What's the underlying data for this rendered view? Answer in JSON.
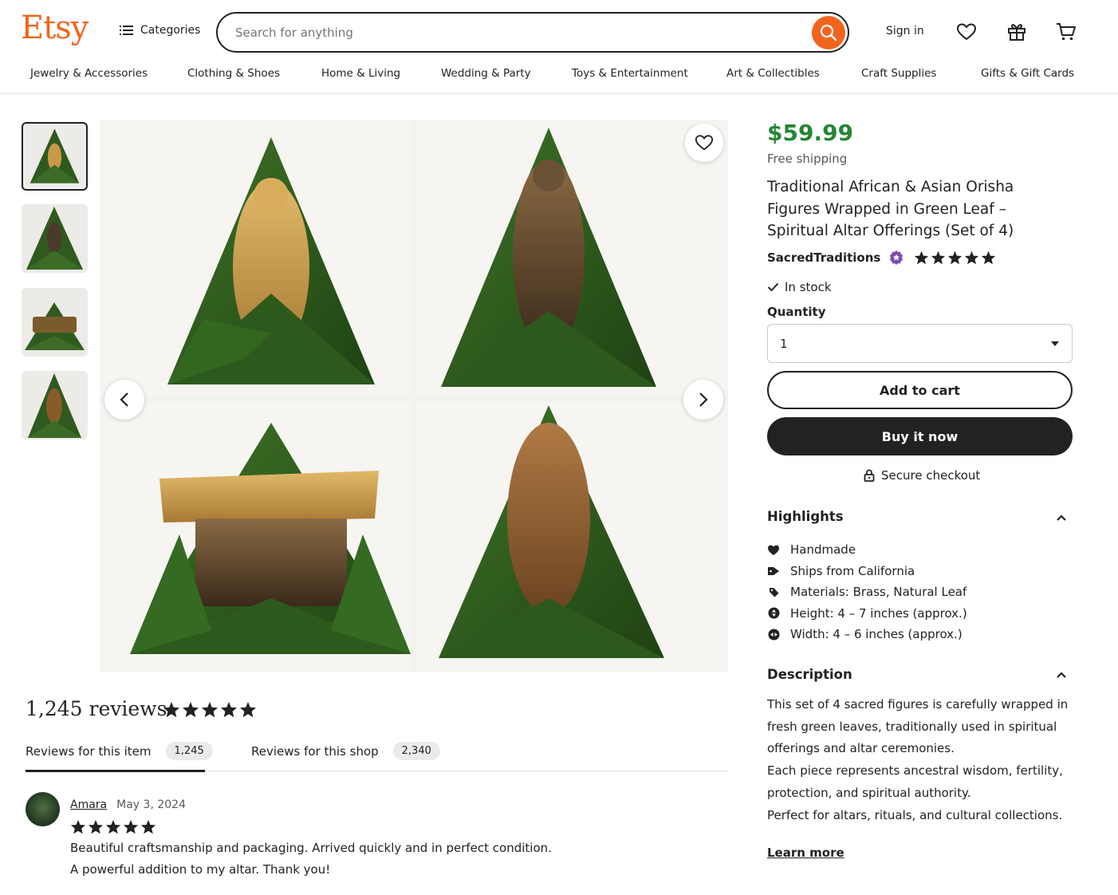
{
  "header": {
    "logo": "Etsy",
    "categories_label": "Categories",
    "search_placeholder": "Search for anything",
    "sign_in": "Sign in"
  },
  "nav": [
    "Jewelry & Accessories",
    "Clothing & Shoes",
    "Home & Living",
    "Wedding & Party",
    "Toys & Entertainment",
    "Art & Collectibles",
    "Craft Supplies",
    "Gifts & Gift Cards"
  ],
  "colors": {
    "brand": "#f1641e",
    "price": "#258635",
    "leaf": "#2f5a1f",
    "badge": "#7d4ab0"
  },
  "gallery": {
    "thumbnails": [
      "thumbnail-fertility-figure",
      "thumbnail-seated-deity",
      "thumbnail-carved-stool",
      "thumbnail-bronze-figure"
    ],
    "active_index": 0
  },
  "product": {
    "price": "$59.99",
    "shipping": "Free shipping",
    "title": "Traditional African & Asian Orisha Figures Wrapped in Green Leaf – Spiritual Altar Offerings (Set of 4)",
    "shop_name": "SacredTraditions",
    "shop_rating": 5,
    "stock": "In stock",
    "quantity_label": "Quantity",
    "quantity_value": "1",
    "add_to_cart": "Add to cart",
    "buy_now": "Buy it now",
    "secure_checkout": "Secure checkout"
  },
  "highlights": {
    "heading": "Highlights",
    "items": [
      {
        "icon": "heart-hand-icon",
        "text": "Handmade"
      },
      {
        "icon": "tag-icon",
        "text": "Ships from California"
      },
      {
        "icon": "materials-icon",
        "text": "Materials: Brass, Natural Leaf"
      },
      {
        "icon": "height-icon",
        "text": "Height: 4 – 7 inches (approx.)"
      },
      {
        "icon": "width-icon",
        "text": "Width: 4 – 6 inches (approx.)"
      }
    ]
  },
  "description": {
    "heading": "Description",
    "paragraphs": [
      "This set of 4 sacred figures is carefully wrapped in fresh green leaves, traditionally used in spiritual offerings and altar ceremonies.",
      "Each piece represents ancestral wisdom, fertility, protection, and spiritual authority.",
      "Perfect for altars, rituals, and cultural collections."
    ],
    "learn_more": "Learn more"
  },
  "reviews": {
    "count_label": "1,245 reviews",
    "rating": 5,
    "tabs": [
      {
        "label": "Reviews for this item",
        "count": "1,245"
      },
      {
        "label": "Reviews for this shop",
        "count": "2,340"
      }
    ],
    "items": [
      {
        "name": "Amara",
        "date": "May 3, 2024",
        "rating": 5,
        "lines": [
          "Beautiful craftsmanship and packaging. Arrived quickly and in perfect condition.",
          "A powerful addition to my altar. Thank you!"
        ]
      }
    ]
  }
}
